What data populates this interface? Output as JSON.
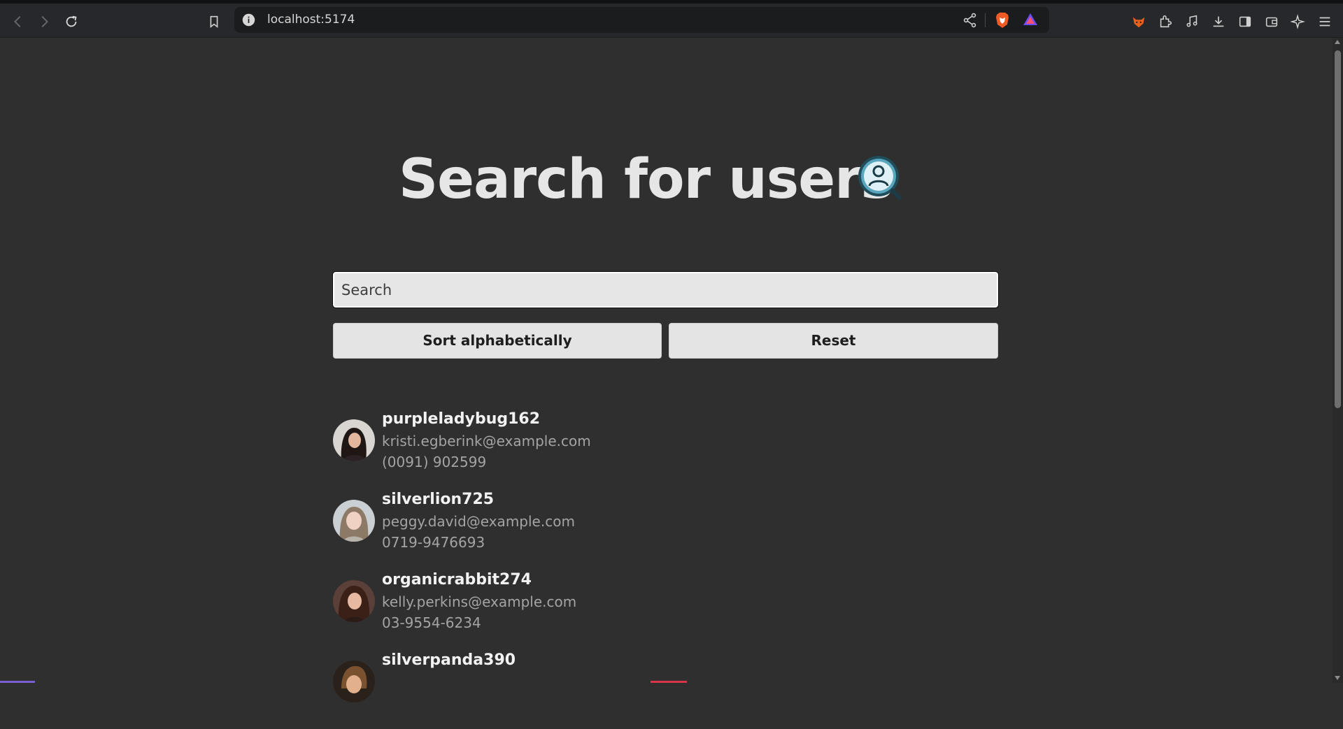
{
  "browser": {
    "url": "localhost:5174",
    "icons": [
      "back-icon",
      "forward-icon",
      "reload-icon",
      "bookmark-icon",
      "site-info-icon",
      "share-icon",
      "brave-shields-icon",
      "brave-rewards-icon",
      "extension-fox-icon",
      "extensions-icon",
      "media-icon",
      "downloads-icon",
      "sidebar-icon",
      "wallet-icon",
      "leo-ai-icon",
      "menu-icon"
    ]
  },
  "page": {
    "title": "Search for users",
    "title_icon": "user-search-icon"
  },
  "search": {
    "placeholder": "Search",
    "value": ""
  },
  "buttons": {
    "sort_label": "Sort alphabetically",
    "reset_label": "Reset"
  },
  "users": [
    {
      "username": "purpleladybug162",
      "email": "kristi.egberink@example.com",
      "phone": "(0091) 902599"
    },
    {
      "username": "silverlion725",
      "email": "peggy.david@example.com",
      "phone": "0719-9476693"
    },
    {
      "username": "organicrabbit274",
      "email": "kelly.perkins@example.com",
      "phone": "03-9554-6234"
    },
    {
      "username": "silverpanda390",
      "email": "",
      "phone": ""
    }
  ],
  "colors": {
    "page_background": "#2f2f2f",
    "toolbar_background": "#27282b",
    "button_background": "#e4e4e4",
    "text_primary": "#f2f2f2",
    "text_secondary": "#a4a4a4"
  }
}
